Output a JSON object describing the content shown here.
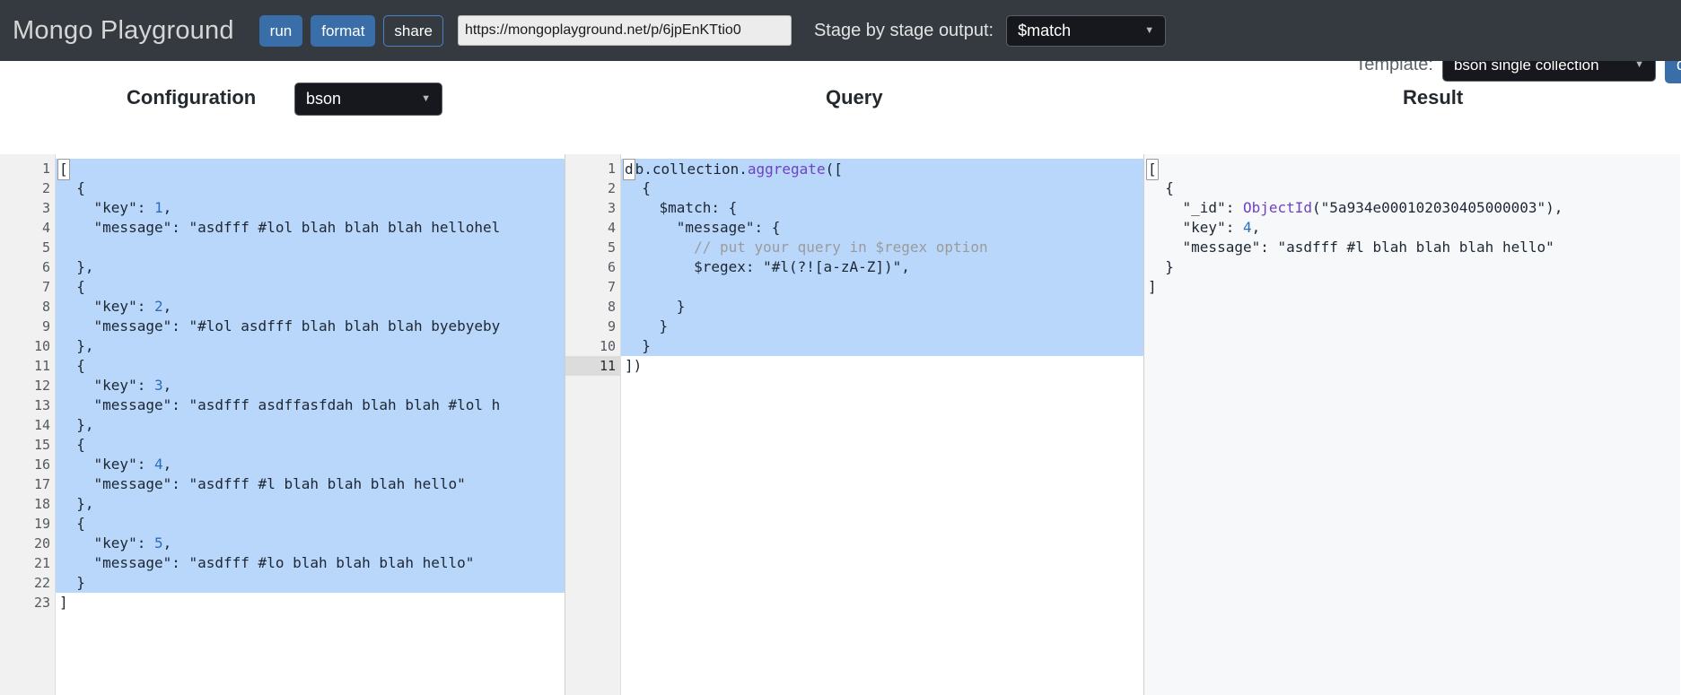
{
  "navbar": {
    "brand": "Mongo Playground",
    "run_label": "run",
    "format_label": "format",
    "share_label": "share",
    "url_value": "https://mongoplayground.net/p/6jpEnKTtio0",
    "url_placeholder": "https://mongoplayground.net/p/",
    "stage_label": "Stage by stage output:",
    "stage_value": "$match",
    "caret_icon": "▼"
  },
  "template_row": {
    "label": "Template:",
    "value": "bson single collection",
    "doc_label": "do",
    "caret_icon": "▼"
  },
  "panels": {
    "configuration_title": "Configuration",
    "configuration_format": "bson",
    "query_title": "Query",
    "result_title": "Result"
  },
  "configuration": {
    "line_numbers": [
      "1",
      "2",
      "3",
      "4",
      "5",
      "6",
      "7",
      "8",
      "9",
      "10",
      "11",
      "12",
      "13",
      "14",
      "15",
      "16",
      "17",
      "18",
      "19",
      "20",
      "21",
      "22",
      "23"
    ],
    "foldable": [
      1,
      2,
      7,
      11,
      15,
      19
    ],
    "lines": [
      "[",
      "  {",
      "    \"key\": 1,",
      "    \"message\": \"asdfff #lol blah blah blah hellohel",
      "",
      "  },",
      "  {",
      "    \"key\": 2,",
      "    \"message\": \"#lol asdfff blah blah blah byebyeby",
      "  },",
      "  {",
      "    \"key\": 3,",
      "    \"message\": \"asdfff asdffasfdah blah blah #lol h",
      "  },",
      "  {",
      "    \"key\": 4,",
      "    \"message\": \"asdfff #l blah blah blah hello\"",
      "  },",
      "  {",
      "    \"key\": 5,",
      "    \"message\": \"asdfff #lo blah blah blah hello\"",
      "  }",
      "]"
    ]
  },
  "query": {
    "line_numbers": [
      "1",
      "2",
      "3",
      "4",
      "5",
      "6",
      "7",
      "8",
      "9",
      "10",
      "11"
    ],
    "foldable": [
      1,
      2,
      3,
      4
    ],
    "active_line": 11,
    "lines": [
      "db.collection.aggregate([",
      "  {",
      "    $match: {",
      "      \"message\": {",
      "        // put your query in $regex option",
      "        $regex: \"#l(?![a-zA-Z])\",",
      "",
      "      }",
      "    }",
      "  }",
      "])"
    ]
  },
  "result": {
    "lines": [
      "[",
      "  {",
      "    \"_id\": ObjectId(\"5a934e000102030405000003\"),",
      "    \"key\": 4,",
      "    \"message\": \"asdfff #l blah blah blah hello\"",
      "  }",
      "]"
    ],
    "object_id": "5a934e000102030405000003",
    "key_value": "4",
    "message_value": "asdfff #l blah blah blah hello"
  },
  "colors": {
    "navbar_bg": "#343a40",
    "accent": "#3a6ea8",
    "selection": "#b9d6fb",
    "number_token": "#2a6ebb",
    "keyword_token": "#6f42c1",
    "comment_token": "#9b9b9b"
  }
}
